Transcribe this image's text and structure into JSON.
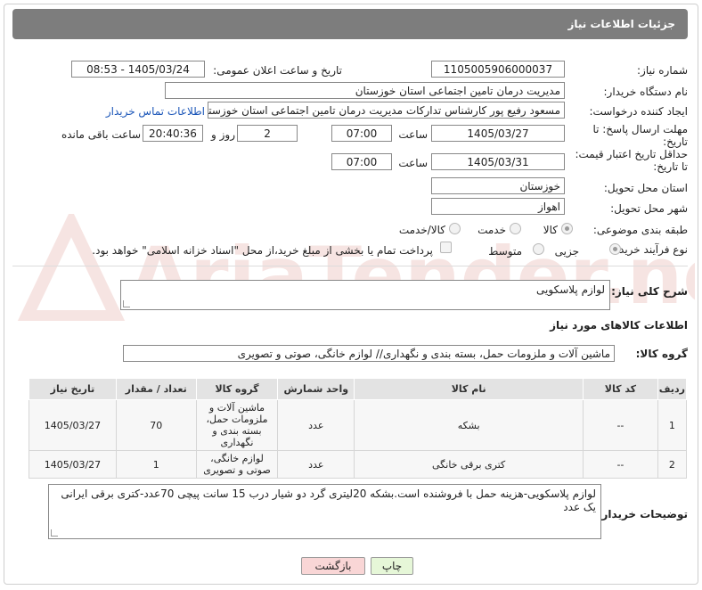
{
  "header": {
    "title": "جزئیات اطلاعات نیاز"
  },
  "fields": {
    "need_number_label": "شماره نیاز:",
    "need_number": "1105005906000037",
    "announce_label": "تاریخ و ساعت اعلان عمومی:",
    "announce_value": "1405/03/24 - 08:53",
    "buyer_org_label": "نام دستگاه خریدار:",
    "buyer_org": "مدیریت درمان تامین اجتماعی استان خوزستان",
    "creator_label": "ایجاد کننده درخواست:",
    "creator": "مسعود رفیع پور کارشناس تدارکات مدیریت درمان تامین اجتماعی استان خوزستان",
    "contact_link": "اطلاعات تماس خریدار",
    "deadline_label": "مهلت ارسال پاسخ: تا تاریخ:",
    "deadline_date": "1405/03/27",
    "time_label": "ساعت",
    "deadline_time": "07:00",
    "days": "2",
    "days_label": "روز و",
    "remaining_time": "20:40:36",
    "remaining_label": "ساعت باقی مانده",
    "validity_label": "حداقل تاریخ اعتبار قیمت: تا تاریخ:",
    "validity_date": "1405/03/31",
    "validity_time": "07:00",
    "province_label": "استان محل تحویل:",
    "province": "خوزستان",
    "city_label": "شهر محل تحویل:",
    "city": "اهواز",
    "category_label": "طبقه بندی موضوعی:",
    "category_options": [
      "کالا",
      "خدمت",
      "کالا/خدمت"
    ],
    "process_label": "نوع فرآیند خرید :",
    "process_options": [
      "جزیی",
      "متوسط"
    ],
    "payment_note": "پرداخت تمام یا بخشی از مبلغ خرید،از محل \"اسناد خزانه اسلامی\" خواهد بود."
  },
  "summary": {
    "label": "شرح کلی نیاز:",
    "value": "لوازم پلاسکویی"
  },
  "goods_section": {
    "title": "اطلاعات کالاهای مورد نیاز"
  },
  "group": {
    "label": "گروه کالا:",
    "value": "ماشین آلات و ملزومات حمل، بسته بندی و نگهداری// لوازم خانگی، صوتی و تصویری"
  },
  "table": {
    "headers": [
      "ردیف",
      "کد کالا",
      "نام کالا",
      "واحد شمارش",
      "گروه کالا",
      "تعداد / مقدار",
      "تاریخ نیاز"
    ],
    "rows": [
      [
        "1",
        "--",
        "بشکه",
        "عدد",
        "ماشین آلات و ملزومات حمل، بسته بندی و نگهداری",
        "70",
        "1405/03/27"
      ],
      [
        "2",
        "--",
        "کتری برقی خانگی",
        "عدد",
        "لوازم خانگی، صوتی و تصویری",
        "1",
        "1405/03/27"
      ]
    ]
  },
  "notes": {
    "label": "توضیحات خریدار:",
    "value": "لوازم پلاسکویی-هزینه حمل با فروشنده است.بشکه 20لیتری گرد دو شیار درب 15 سانت پیچی 70عدد-کتری برقی ایرانی یک عدد"
  },
  "buttons": {
    "print": "چاپ",
    "back": "بازگشت"
  },
  "colors": {
    "header_bg": "#7d7d7d",
    "link": "#1a55b8",
    "back_btn_bg": "#f9d6d6",
    "print_btn_bg": "#e6f7d8"
  },
  "watermark": "AriaTender.neT"
}
